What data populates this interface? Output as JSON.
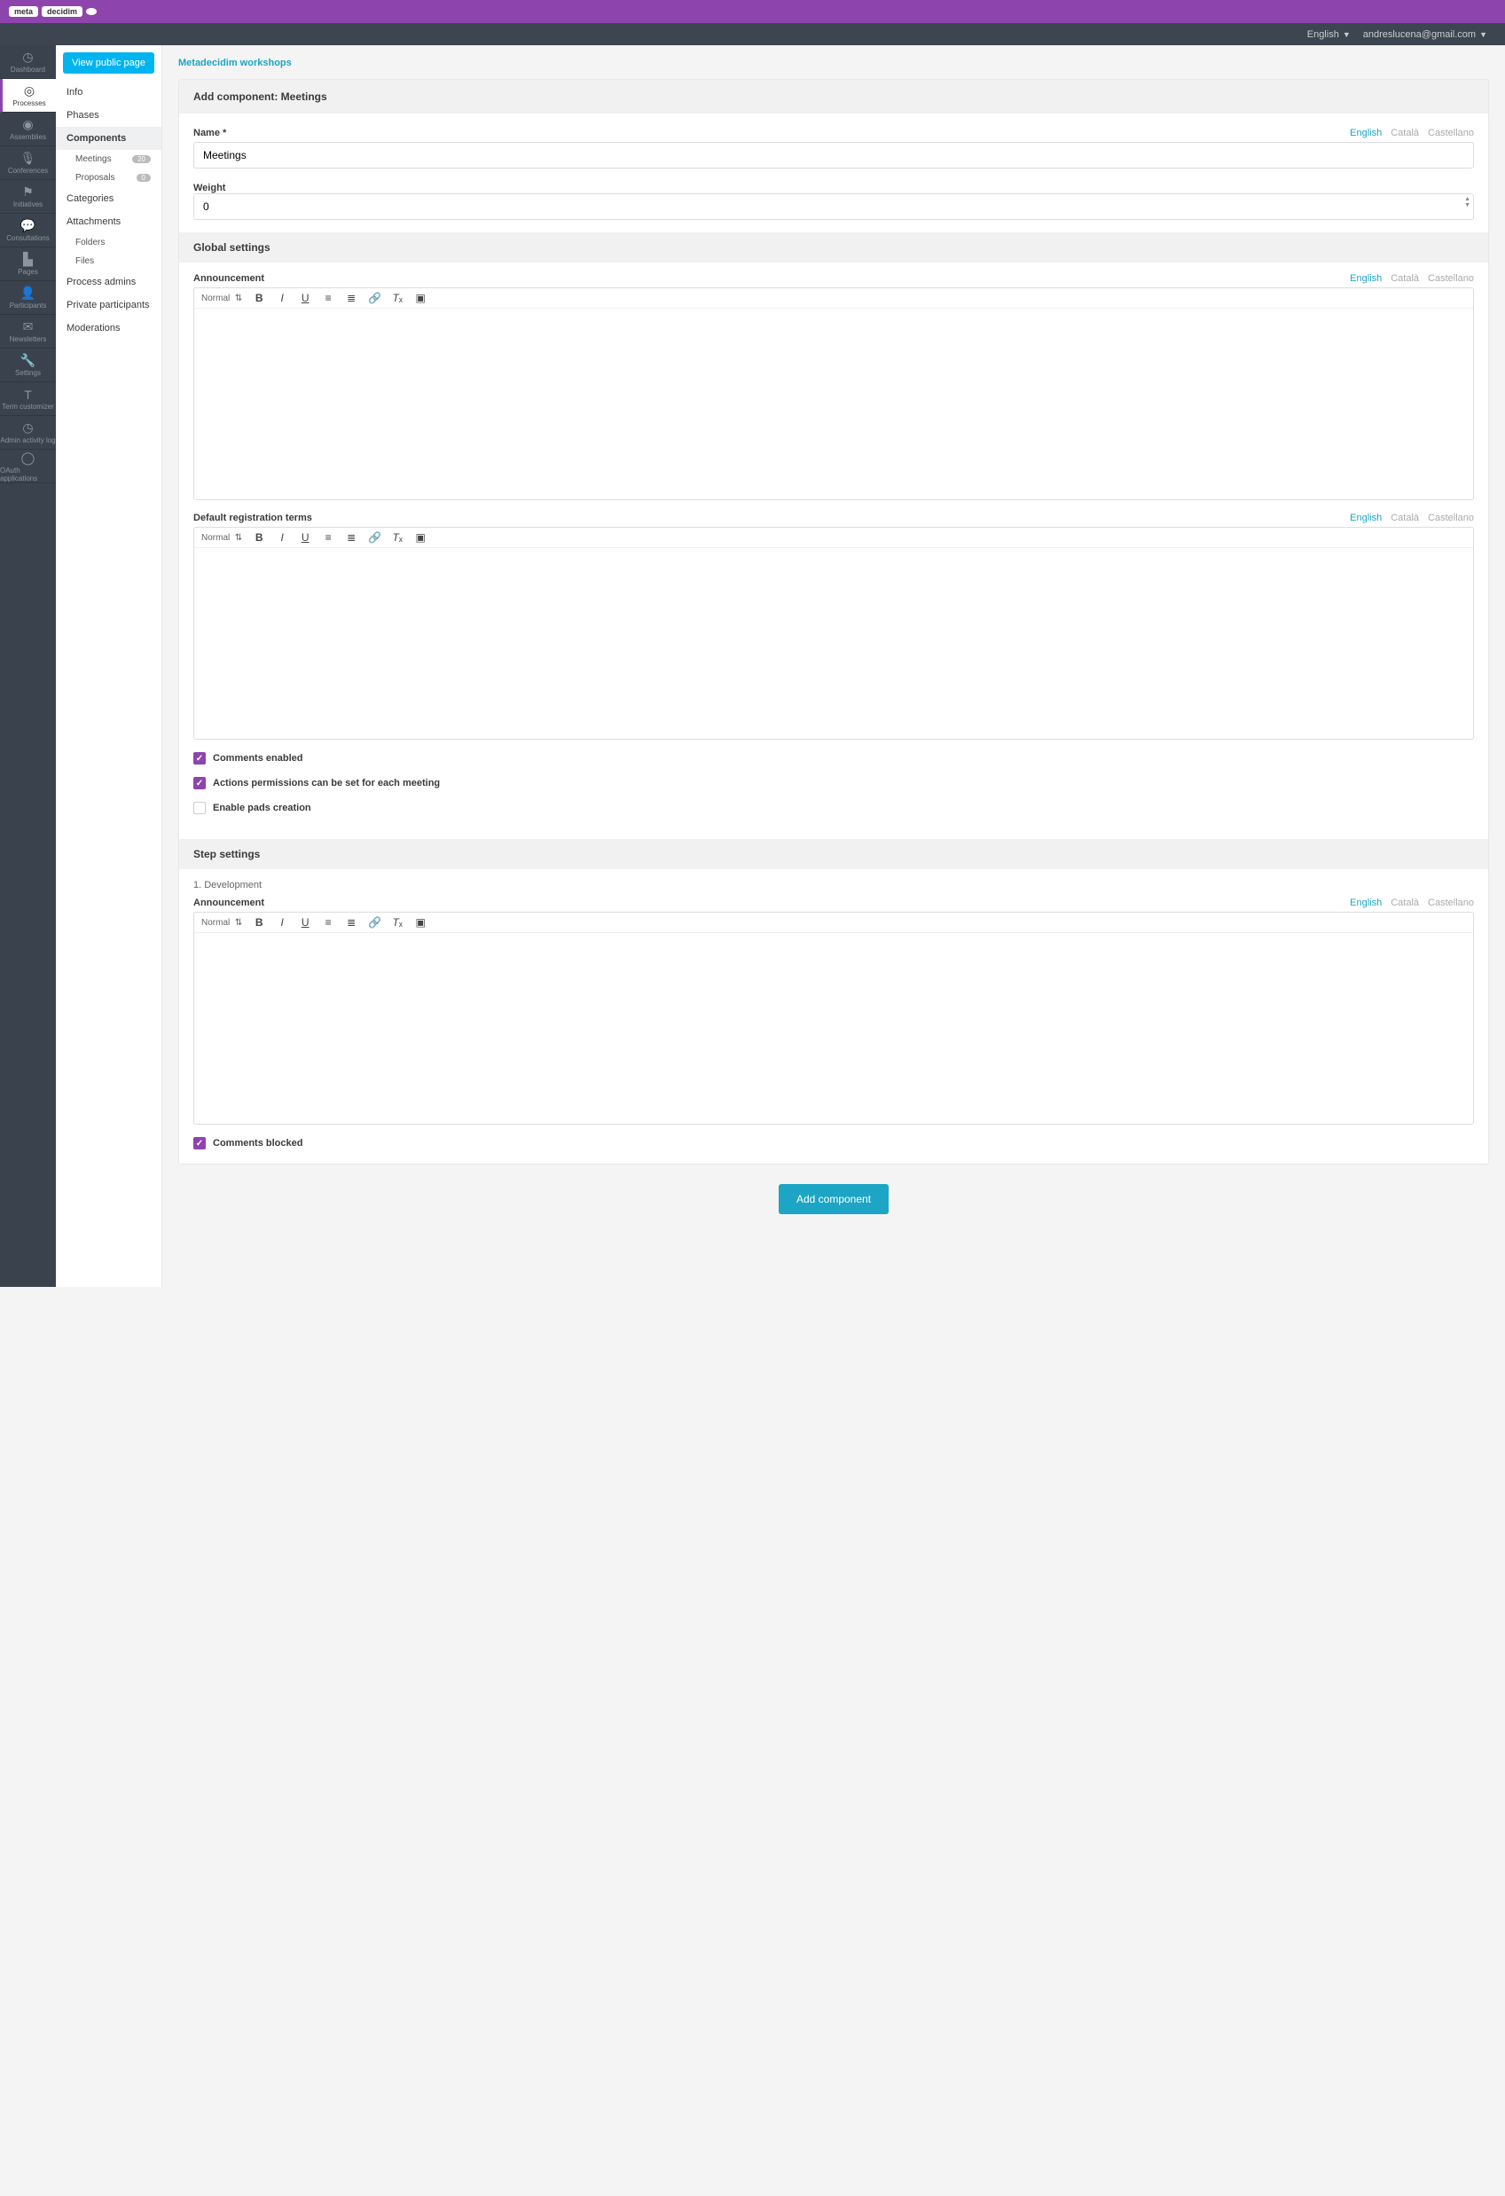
{
  "topbar": {
    "logo_left": "meta",
    "logo_right": "decidim"
  },
  "navbar": {
    "language": "English",
    "user": "andreslucena@gmail.com"
  },
  "sidebar": {
    "items": [
      {
        "label": "Dashboard"
      },
      {
        "label": "Processes"
      },
      {
        "label": "Assemblies"
      },
      {
        "label": "Conferences"
      },
      {
        "label": "Initiatives"
      },
      {
        "label": "Consultations"
      },
      {
        "label": "Pages"
      },
      {
        "label": "Participants"
      },
      {
        "label": "Newsletters"
      },
      {
        "label": "Settings"
      },
      {
        "label": "Term customizer"
      },
      {
        "label": "Admin activity log"
      },
      {
        "label": "OAuth applications"
      }
    ]
  },
  "secondary": {
    "view_public": "View public page",
    "items": {
      "info": "Info",
      "phases": "Phases",
      "components": "Components",
      "meetings": "Meetings",
      "meetings_badge": "20",
      "proposals": "Proposals",
      "proposals_badge": "0",
      "categories": "Categories",
      "attachments": "Attachments",
      "folders": "Folders",
      "files": "Files",
      "process_admins": "Process admins",
      "private": "Private participants",
      "moderations": "Moderations"
    }
  },
  "breadcrumb": "Metadecidim workshops",
  "form": {
    "title": "Add component: Meetings",
    "name_label": "Name *",
    "name_value": "Meetings",
    "weight_label": "Weight",
    "weight_value": "0",
    "global_settings": "Global settings",
    "announcement": "Announcement",
    "default_reg": "Default registration terms",
    "comments_enabled": "Comments enabled",
    "actions_perms": "Actions permissions can be set for each meeting",
    "enable_pads": "Enable pads creation",
    "step_settings": "Step settings",
    "step1": "1. Development",
    "comments_blocked": "Comments blocked",
    "submit": "Add component",
    "rte_normal": "Normal"
  },
  "langs": {
    "en": "English",
    "ca": "Català",
    "es": "Castellano"
  }
}
